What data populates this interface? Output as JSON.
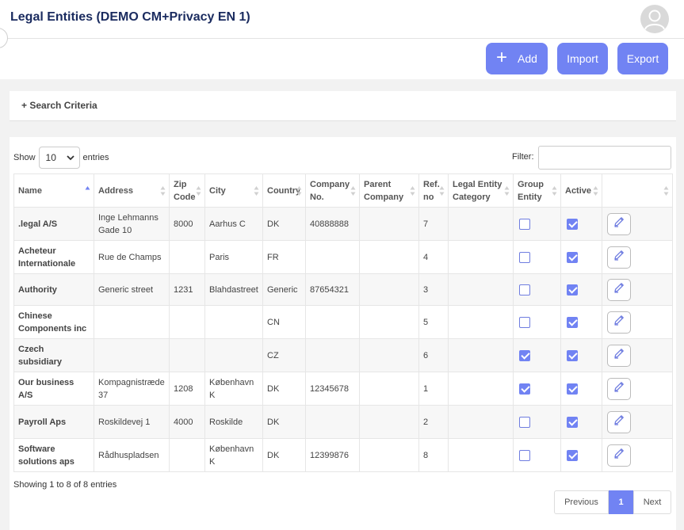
{
  "header": {
    "title": "Legal Entities (DEMO CM+Privacy EN 1)"
  },
  "actions": {
    "add_label": "Add",
    "import_label": "Import",
    "export_label": "Export"
  },
  "search": {
    "toggle_label": "+ Search Criteria"
  },
  "table_controls": {
    "show_label": "Show",
    "page_size": "10",
    "entries_label": "entries",
    "filter_label": "Filter:",
    "filter_value": ""
  },
  "columns": [
    {
      "line1": "Name",
      "line2": ""
    },
    {
      "line1": "Address",
      "line2": ""
    },
    {
      "line1": "Zip",
      "line2": "Code"
    },
    {
      "line1": "City",
      "line2": ""
    },
    {
      "line1": "Country",
      "line2": ""
    },
    {
      "line1": "Company",
      "line2": "No."
    },
    {
      "line1": "Parent",
      "line2": "Company"
    },
    {
      "line1": "Ref.",
      "line2": "no"
    },
    {
      "line1": "Legal Entity",
      "line2": "Category"
    },
    {
      "line1": "Group",
      "line2": "Entity"
    },
    {
      "line1": "Active",
      "line2": ""
    },
    {
      "line1": "",
      "line2": ""
    }
  ],
  "rows": [
    {
      "name_1": ".legal A/S",
      "name_2": "",
      "address_1": "Inge Lehmanns",
      "address_2": "Gade 10",
      "zip": "8000",
      "city_1": "Aarhus C",
      "city_2": "",
      "country": "DK",
      "company_no": "40888888",
      "parent": "",
      "ref": "7",
      "category": "",
      "group": false,
      "active": true
    },
    {
      "name_1": "Acheteur",
      "name_2": "Internationale",
      "address_1": "Rue de Champs",
      "address_2": "",
      "zip": "",
      "city_1": "Paris",
      "city_2": "",
      "country": "FR",
      "company_no": "",
      "parent": "",
      "ref": "4",
      "category": "",
      "group": false,
      "active": true
    },
    {
      "name_1": "Authority",
      "name_2": "",
      "address_1": "Generic street",
      "address_2": "",
      "zip": "1231",
      "city_1": "Blahdastreet",
      "city_2": "",
      "country": "Generic",
      "company_no": "87654321",
      "parent": "",
      "ref": "3",
      "category": "",
      "group": false,
      "active": true
    },
    {
      "name_1": "Chinese",
      "name_2": "Components inc",
      "address_1": "",
      "address_2": "",
      "zip": "",
      "city_1": "",
      "city_2": "",
      "country": "CN",
      "company_no": "",
      "parent": "",
      "ref": "5",
      "category": "",
      "group": false,
      "active": true
    },
    {
      "name_1": "Czech",
      "name_2": "subsidiary",
      "address_1": "",
      "address_2": "",
      "zip": "",
      "city_1": "",
      "city_2": "",
      "country": "CZ",
      "company_no": "",
      "parent": "",
      "ref": "6",
      "category": "",
      "group": true,
      "active": true
    },
    {
      "name_1": "Our business",
      "name_2": "A/S",
      "address_1": "Kompagnistræde",
      "address_2": "37",
      "zip": "1208",
      "city_1": "København",
      "city_2": "K",
      "country": "DK",
      "company_no": "12345678",
      "parent": "",
      "ref": "1",
      "category": "",
      "group": true,
      "active": true
    },
    {
      "name_1": "Payroll Aps",
      "name_2": "",
      "address_1": "Roskildevej 1",
      "address_2": "",
      "zip": "4000",
      "city_1": "Roskilde",
      "city_2": "",
      "country": "DK",
      "company_no": "",
      "parent": "",
      "ref": "2",
      "category": "",
      "group": false,
      "active": true
    },
    {
      "name_1": "Software",
      "name_2": "solutions aps",
      "address_1": "Rådhuspladsen",
      "address_2": "",
      "zip": "",
      "city_1": "København",
      "city_2": "K",
      "country": "DK",
      "company_no": "12399876",
      "parent": "",
      "ref": "8",
      "category": "",
      "group": false,
      "active": true
    }
  ],
  "footer": {
    "info": "Showing 1 to 8 of 8 entries",
    "prev_label": "Previous",
    "current_page": "1",
    "next_label": "Next"
  },
  "colors": {
    "accent": "#7183f3",
    "title": "#1a2b5f",
    "row_stripe": "#f7f7f7"
  },
  "icons": [
    "user-avatar-icon",
    "plus-icon",
    "chevron-down-icon",
    "sort-icon",
    "pencil-icon",
    "checkbox-icon"
  ]
}
